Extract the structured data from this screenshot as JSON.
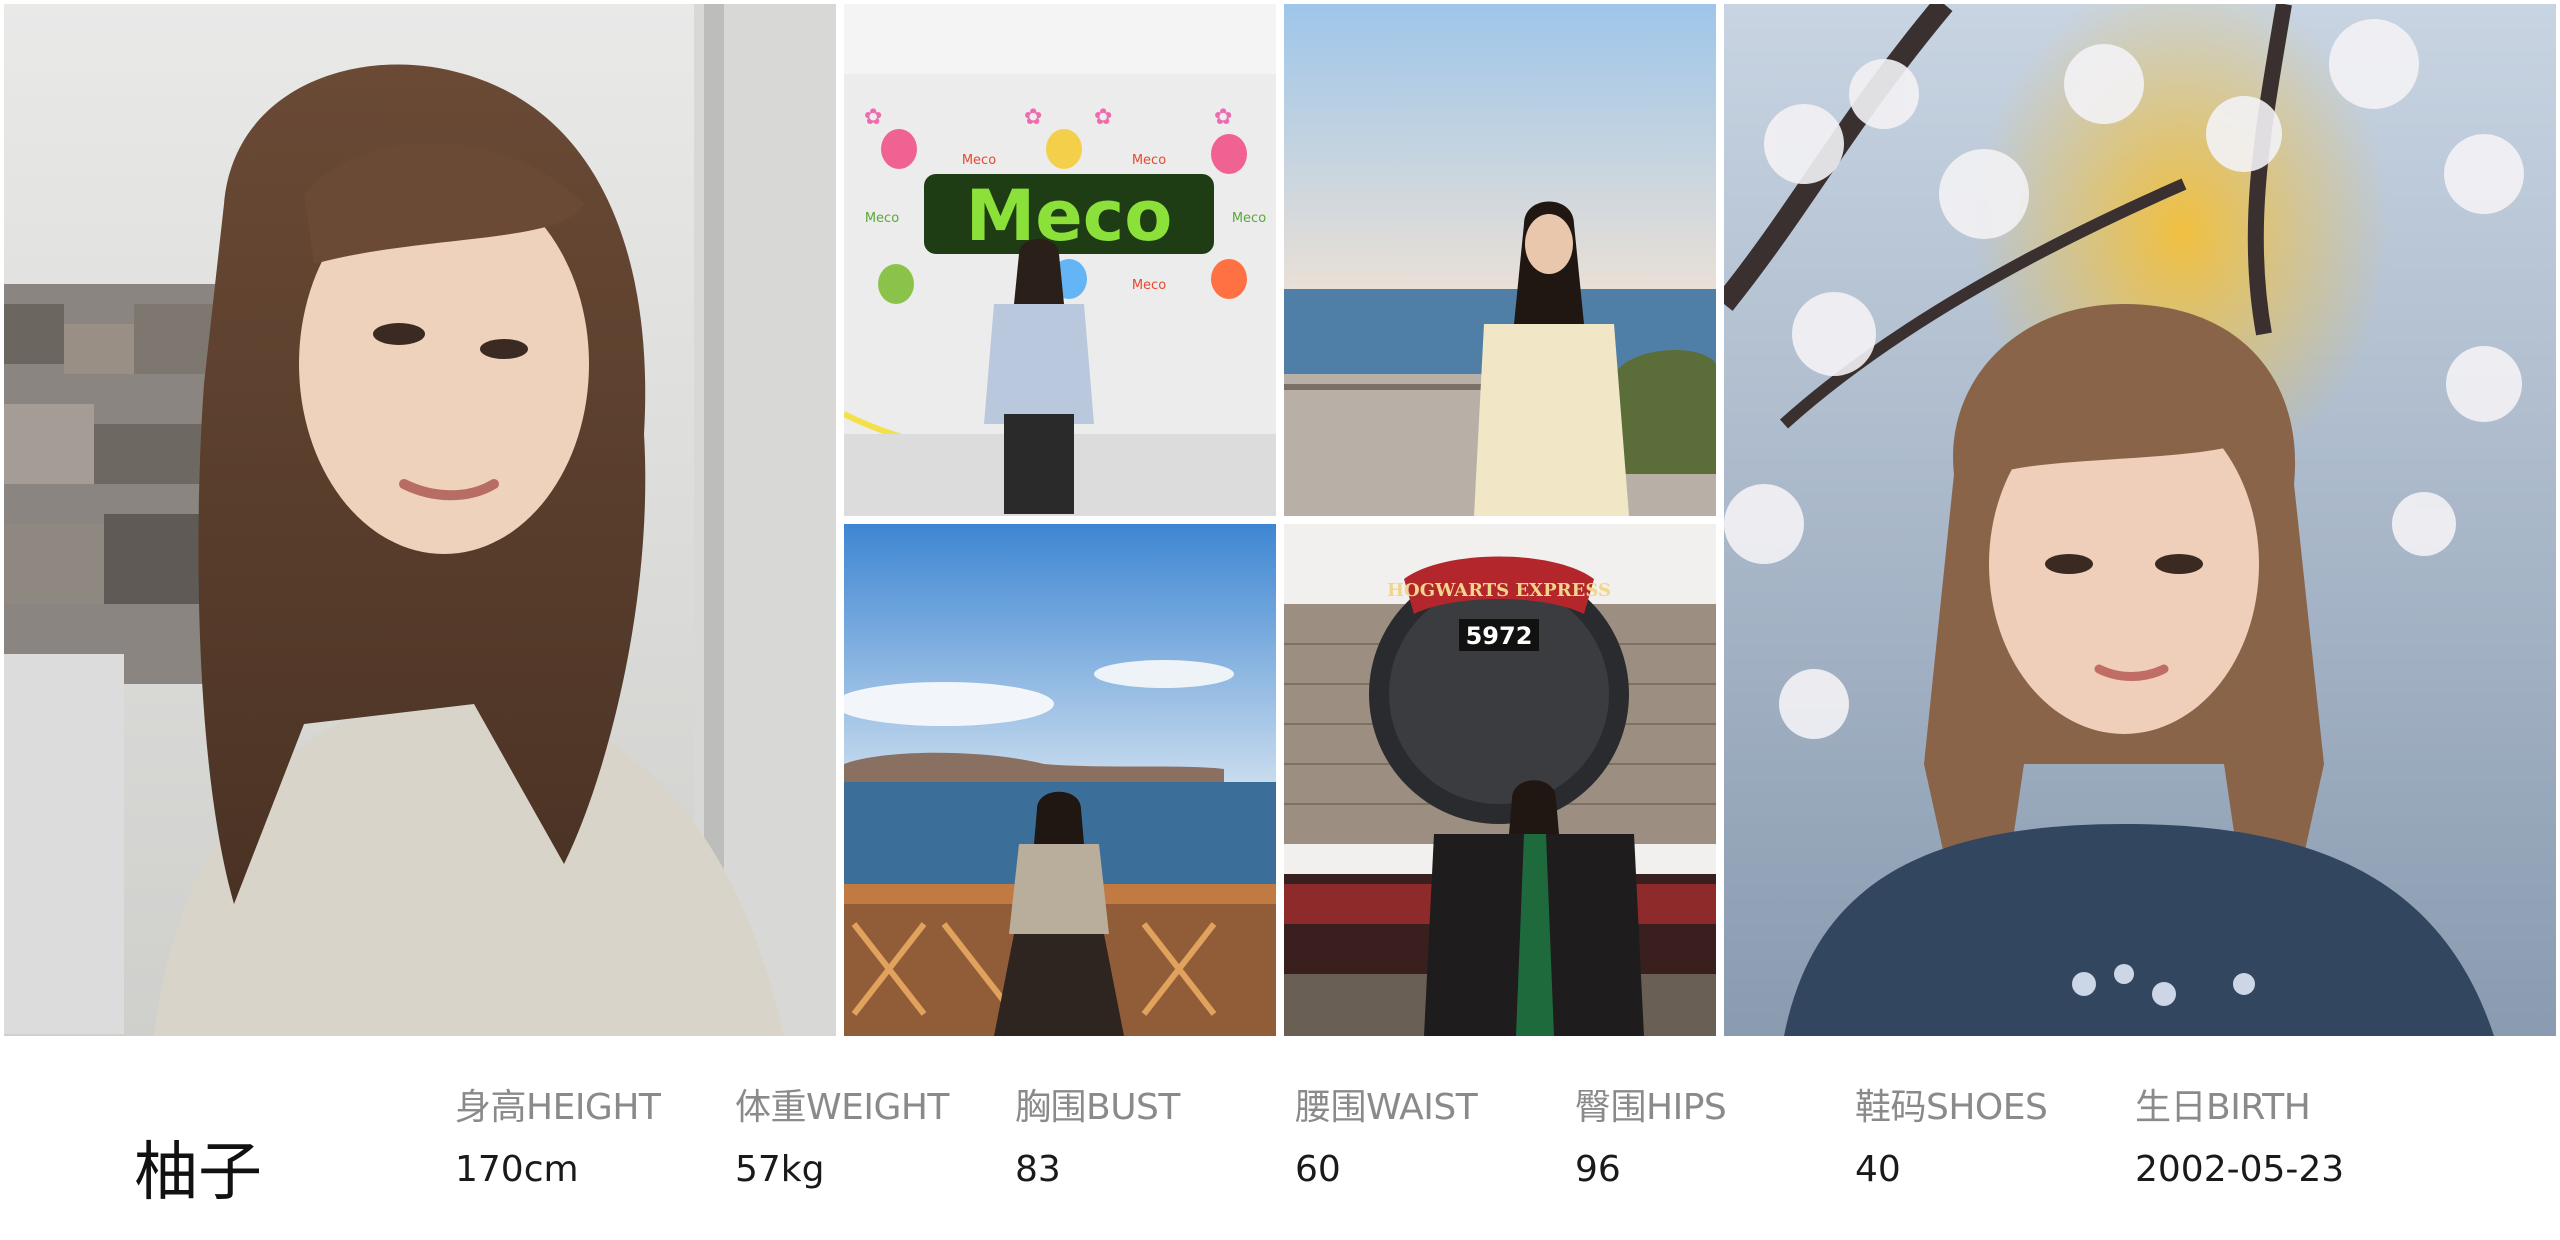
{
  "model": {
    "name": "柚子"
  },
  "stats": [
    {
      "label": "身高HEIGHT",
      "value": "170cm"
    },
    {
      "label": "体重WEIGHT",
      "value": "57kg"
    },
    {
      "label": "胸围BUST",
      "value": "83"
    },
    {
      "label": "腰围WAIST",
      "value": "60"
    },
    {
      "label": "臀围HIPS",
      "value": "96"
    },
    {
      "label": "鞋码SHOES",
      "value": "40"
    },
    {
      "label": "生日BIRTH",
      "value": "2002-05-23"
    }
  ],
  "photos": {
    "meco_sign": {
      "title": "Meco",
      "small_labels": [
        "Meco",
        "Meco",
        "Meco",
        "Meco",
        "Meco"
      ]
    },
    "train": {
      "plate": "HOGWARTS EXPRESS",
      "number": "5972"
    }
  },
  "colors": {
    "label": "#8a8a8a",
    "value": "#1a1a1a",
    "name": "#111111",
    "background": "#ffffff"
  }
}
